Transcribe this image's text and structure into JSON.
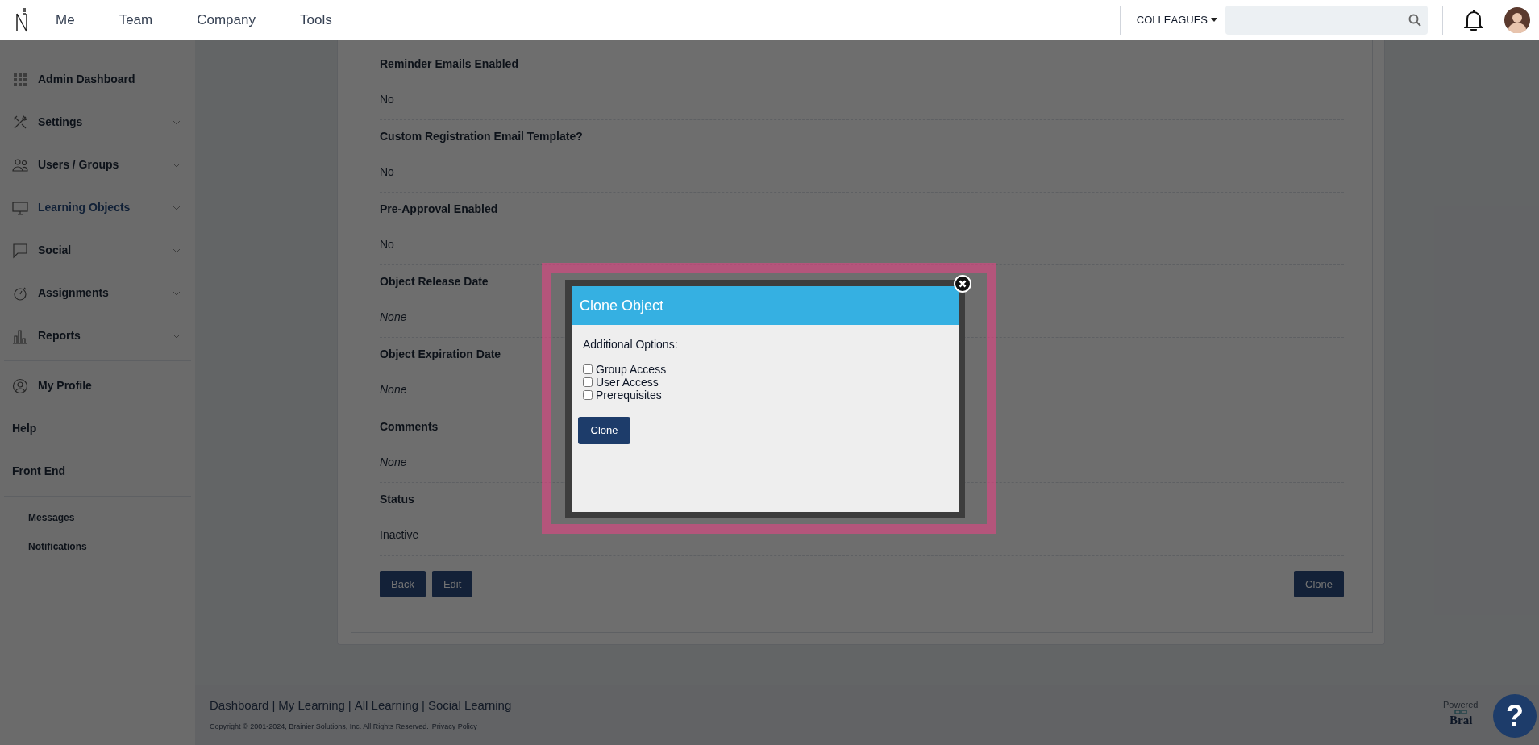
{
  "top_nav": {
    "items": [
      "Me",
      "Team",
      "Company",
      "Tools"
    ],
    "colleagues_menu": "COLLEAGUES"
  },
  "sidebar": {
    "sections": [
      {
        "kind": "main",
        "items": [
          {
            "label": "Admin Dashboard",
            "expandable": false,
            "selected": false
          },
          {
            "label": "Settings",
            "expandable": true,
            "selected": false
          },
          {
            "label": "Users / Groups",
            "expandable": true,
            "selected": false
          },
          {
            "label": "Learning Objects",
            "expandable": true,
            "selected": true
          },
          {
            "label": "Social",
            "expandable": true,
            "selected": false
          },
          {
            "label": "Assignments",
            "expandable": true,
            "selected": false
          },
          {
            "label": "Reports",
            "expandable": true,
            "selected": false
          }
        ]
      },
      {
        "kind": "plain",
        "items": [
          {
            "label": "My Profile",
            "selected": false
          },
          {
            "label": "Help",
            "selected": false
          },
          {
            "label": "Front End",
            "selected": false
          }
        ]
      },
      {
        "kind": "sub",
        "items": [
          {
            "label": "Messages",
            "selected": false
          },
          {
            "label": "Notifications",
            "selected": false
          }
        ]
      }
    ]
  },
  "details": [
    {
      "label": "Reminder Emails Enabled",
      "value": "No",
      "unset": false
    },
    {
      "label": "Custom Registration Email Template?",
      "value": "No",
      "unset": false
    },
    {
      "label": "Pre-Approval Enabled",
      "value": "No",
      "unset": false
    },
    {
      "label": "Object Release Date",
      "value": "None",
      "unset": true
    },
    {
      "label": "Object Expiration Date",
      "value": "None",
      "unset": true
    },
    {
      "label": "Comments",
      "value": "None",
      "unset": true
    },
    {
      "label": "Status",
      "value": "Inactive",
      "unset": false
    }
  ],
  "actions": {
    "left": [
      "Back",
      "Edit"
    ],
    "right": [
      "Clone"
    ]
  },
  "footer": {
    "links": [
      "Dashboard",
      "My Learning",
      "All Learning",
      "Social Learning"
    ],
    "separator": "|",
    "copyright": "Copyright © 2001-2024, Brainier Solutions, Inc. All Rights Reserved.",
    "privacy_link": "Privacy Policy",
    "powered": "Powered",
    "brand": "Brai"
  },
  "dialog": {
    "title": "Clone Object",
    "prompt": "Additional Options:",
    "options": [
      {
        "label": "Group Access",
        "checked": false
      },
      {
        "label": "User Access",
        "checked": false
      },
      {
        "label": "Prerequisites",
        "checked": false
      }
    ],
    "button": "Clone"
  },
  "help_button": "?"
}
